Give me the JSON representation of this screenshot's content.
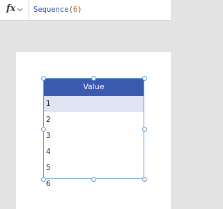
{
  "formula_bar": {
    "fx_label": "fx",
    "formula_name": "Sequence",
    "formula_open": "(",
    "formula_arg": "6",
    "formula_close": ")"
  },
  "gallery": {
    "header": "Value",
    "rows": [
      "1",
      "2",
      "3",
      "4",
      "5",
      "6"
    ],
    "selected_row_index": 0
  },
  "colors": {
    "header_bg": "#3a5ab0",
    "selected_row_bg": "#dfe3f2",
    "selection_border": "#5b9bd5",
    "formula_function": "#2c56b0",
    "formula_number": "#c05a1a"
  },
  "icons": {
    "fx_dropdown": "chevron-down-icon"
  }
}
